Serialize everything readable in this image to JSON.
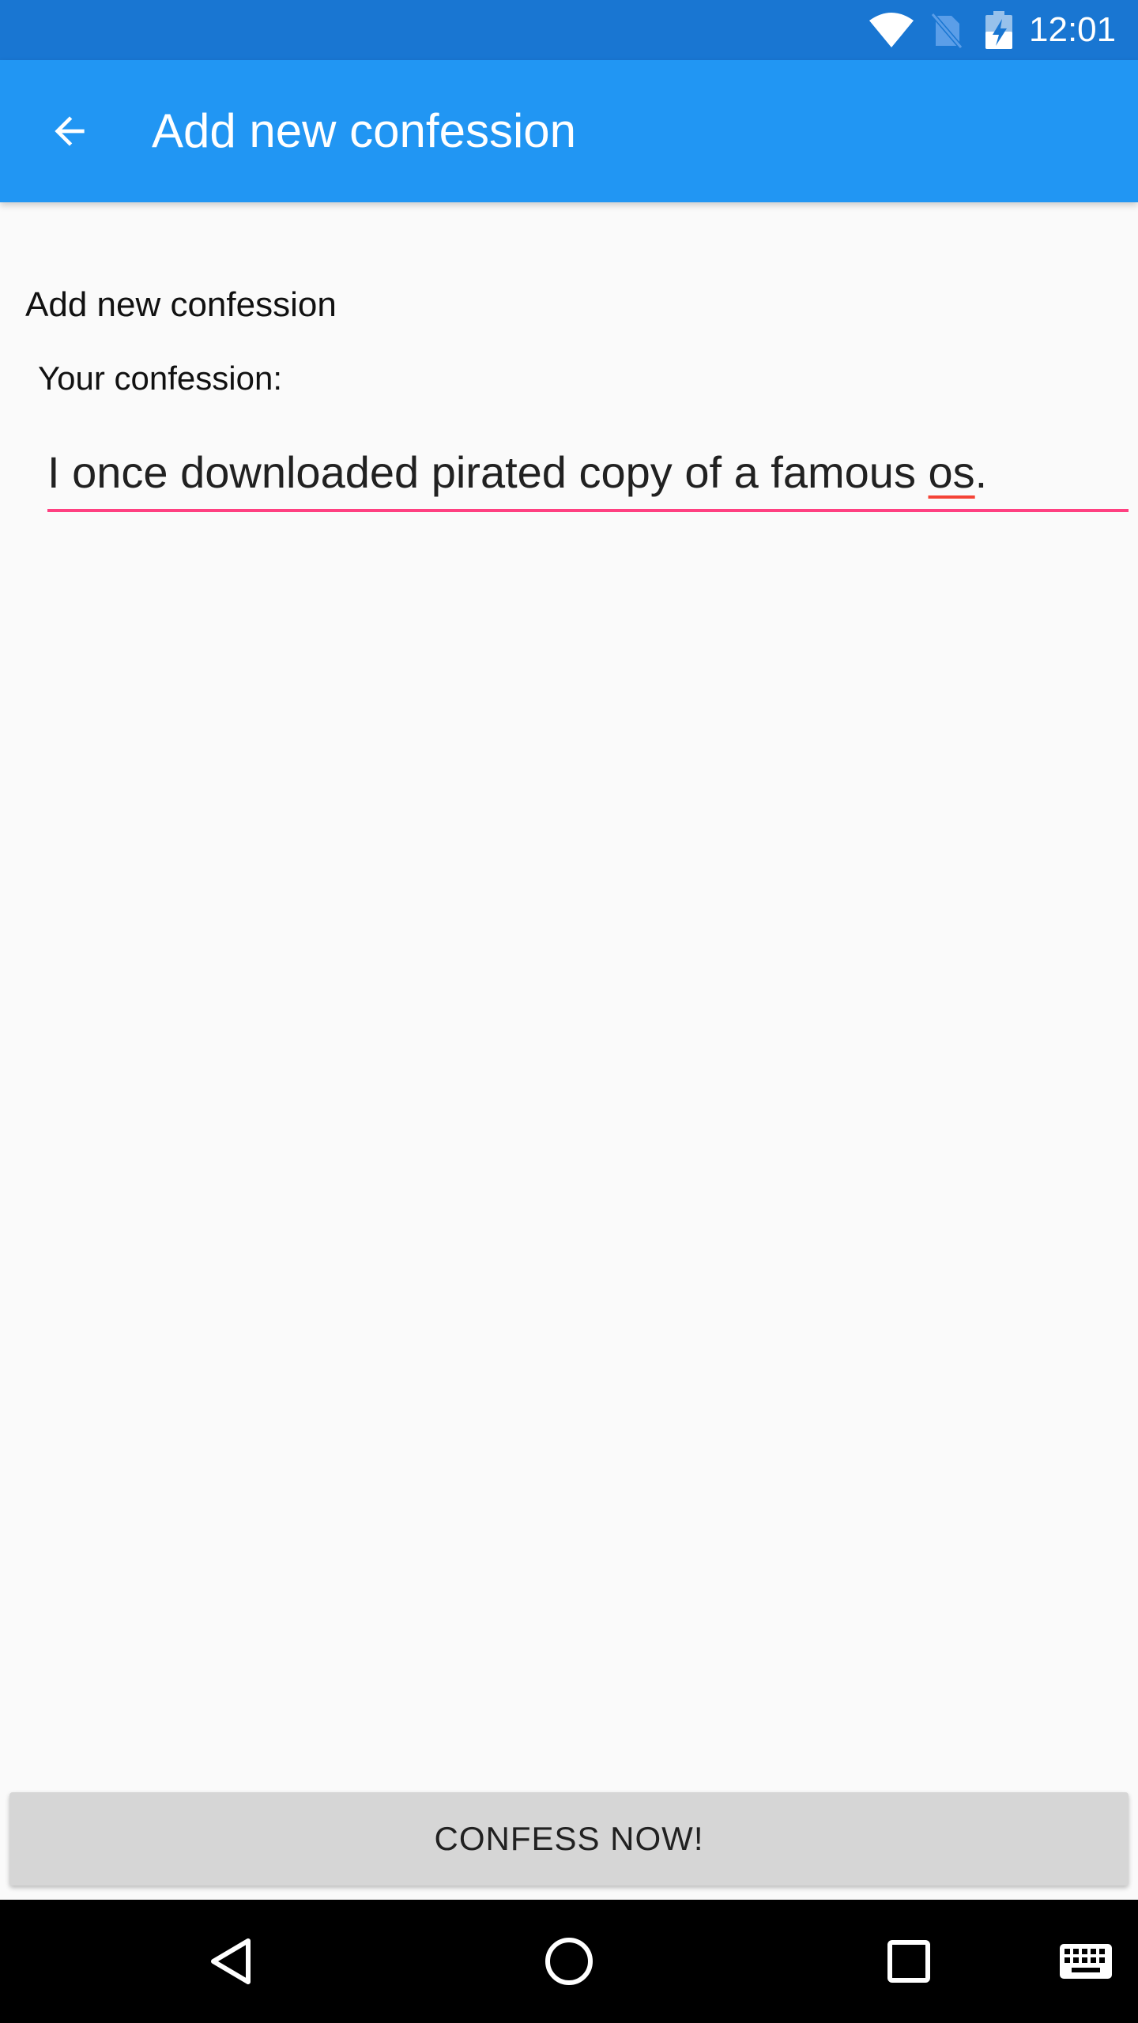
{
  "status_bar": {
    "time": "12:01",
    "icons": [
      "wifi-icon",
      "no-sim-icon",
      "battery-charging-icon"
    ],
    "background_color": "#1976d2"
  },
  "app_bar": {
    "title": "Add new confession",
    "back_icon": "arrow-back-icon",
    "background_color": "#2196f3"
  },
  "content": {
    "heading": "Add new confession",
    "field_label": "Your confession:",
    "input": {
      "value_before": "I once downloaded pirated copy of a famous ",
      "value_misspelled": "os",
      "value_after": ".",
      "underline_color": "#ff4081",
      "spellcheck_color": "#f44336"
    }
  },
  "confess_button": {
    "label": "CONFESS NOW!",
    "background_color": "#d6d6d6"
  },
  "navigation_bar": {
    "buttons": [
      "nav-back-icon",
      "nav-home-icon",
      "nav-recents-icon",
      "keyboard-icon"
    ]
  }
}
